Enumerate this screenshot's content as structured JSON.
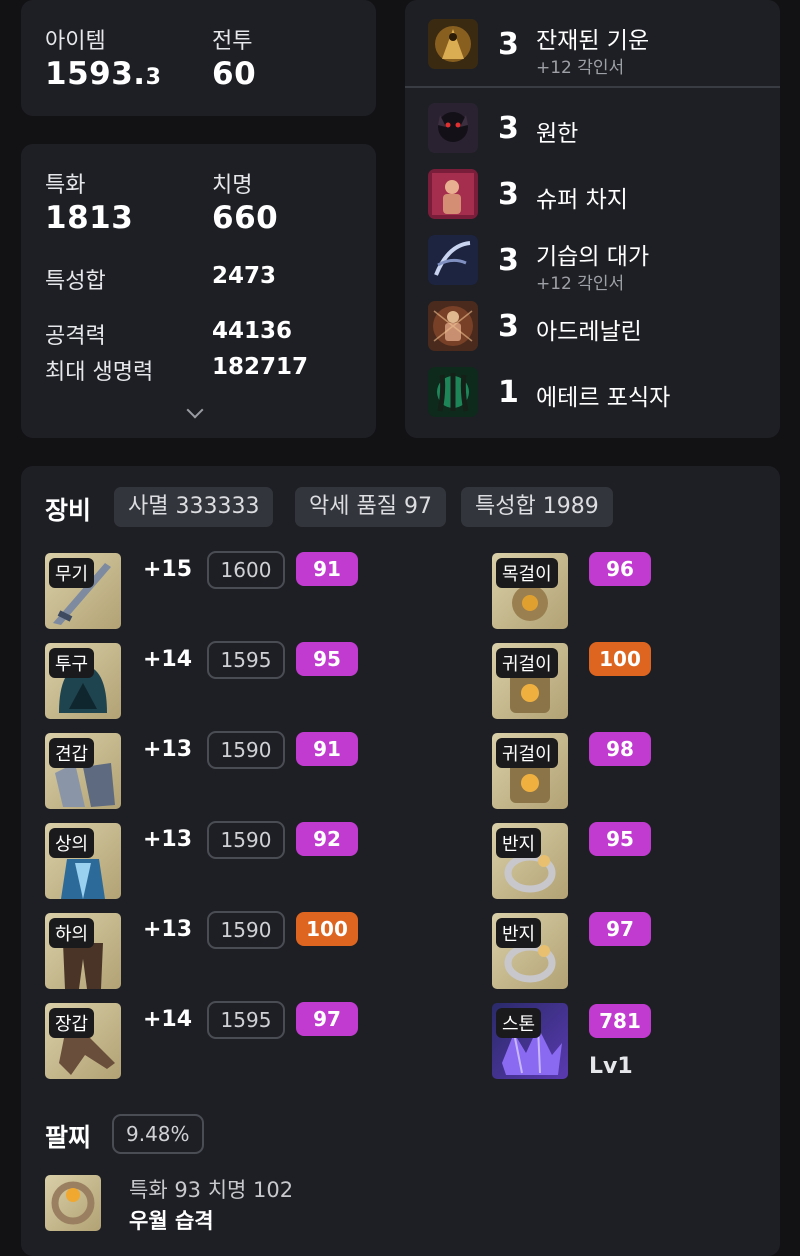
{
  "summary": {
    "item_label": "아이템",
    "item_level_main": "1593.",
    "item_level_frac": "3",
    "combat_label": "전투",
    "combat_level": "60"
  },
  "stats": {
    "spec_label": "특화",
    "spec_value": "1813",
    "crit_label": "치명",
    "crit_value": "660",
    "total_label": "특성합",
    "total_value": "2473",
    "atk_label": "공격력",
    "atk_value": "44136",
    "hp_label": "최대 생명력",
    "hp_value": "182717"
  },
  "engravings": [
    {
      "level": "3",
      "name": "잔재된 기운",
      "sub": "+12 각인서"
    },
    {
      "level": "3",
      "name": "원한",
      "sub": ""
    },
    {
      "level": "3",
      "name": "슈퍼 차지",
      "sub": ""
    },
    {
      "level": "3",
      "name": "기습의 대가",
      "sub": "+12 각인서"
    },
    {
      "level": "3",
      "name": "아드레날린",
      "sub": ""
    },
    {
      "level": "1",
      "name": "에테르 포식자",
      "sub": ""
    }
  ],
  "equipment": {
    "title": "장비",
    "chips": [
      "사멸 333333",
      "악세 품질 97",
      "특성합 1989"
    ],
    "armor": [
      {
        "slot": "무기",
        "upgrade": "+15",
        "ilvl": "1600",
        "quality": "91",
        "quality_color": "#c13bd0"
      },
      {
        "slot": "투구",
        "upgrade": "+14",
        "ilvl": "1595",
        "quality": "95",
        "quality_color": "#c13bd0"
      },
      {
        "slot": "견갑",
        "upgrade": "+13",
        "ilvl": "1590",
        "quality": "91",
        "quality_color": "#c13bd0"
      },
      {
        "slot": "상의",
        "upgrade": "+13",
        "ilvl": "1590",
        "quality": "92",
        "quality_color": "#c13bd0"
      },
      {
        "slot": "하의",
        "upgrade": "+13",
        "ilvl": "1590",
        "quality": "100",
        "quality_color": "#dd6520"
      },
      {
        "slot": "장갑",
        "upgrade": "+14",
        "ilvl": "1595",
        "quality": "97",
        "quality_color": "#c13bd0"
      }
    ],
    "accessories": [
      {
        "slot": "목걸이",
        "quality": "96",
        "quality_color": "#c13bd0"
      },
      {
        "slot": "귀걸이",
        "quality": "100",
        "quality_color": "#dd6520"
      },
      {
        "slot": "귀걸이",
        "quality": "98",
        "quality_color": "#c13bd0"
      },
      {
        "slot": "반지",
        "quality": "95",
        "quality_color": "#c13bd0"
      },
      {
        "slot": "반지",
        "quality": "97",
        "quality_color": "#c13bd0"
      },
      {
        "slot": "스톤",
        "quality": "781",
        "quality_color": "#c13bd0",
        "level": "Lv1"
      }
    ]
  },
  "bracelet": {
    "title": "팔찌",
    "percent": "9.48%",
    "line1": "특화 93  치명 102",
    "line2": "우월  습격"
  }
}
